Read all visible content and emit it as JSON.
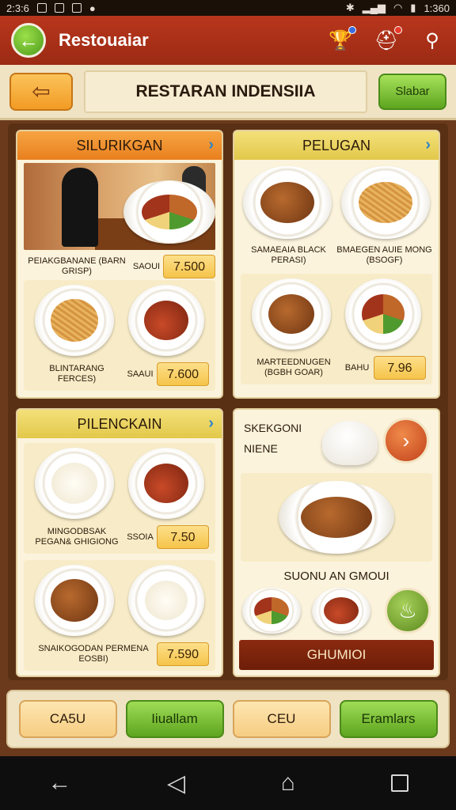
{
  "status_bar": {
    "time": "2:3:6",
    "battery": "1:360"
  },
  "app_bar": {
    "title": "Restouaiar"
  },
  "header": {
    "title": "RESTARAN INDENSIIA",
    "action_label": "Slabar"
  },
  "cards": {
    "c1": {
      "title": "SILURIKGAN",
      "r1": {
        "name": "PEIAKGBANANE (BARN GRISP)",
        "mid": "SAOUI",
        "price": "7.500"
      },
      "r2": {
        "name": "BLINTARANG FERCES)",
        "mid": "SAAUI",
        "price": "7.600"
      }
    },
    "c2": {
      "title": "PELUGAN",
      "r1": {
        "name": "SAMAEAIA BLACK PERASI)",
        "name2": "BMAEGEN AUIE MONG (BSOGF)"
      },
      "r2": {
        "name": "MARTEEDNUGEN (BGBH GOAR)",
        "mid": "BAHU",
        "price": "7.96"
      }
    },
    "c3": {
      "title": "PILENCKAIN",
      "r1": {
        "name": "MINGODBSAK PEGAN& GHIGIONG",
        "mid": "SSOIA",
        "price": "7.50"
      },
      "r2": {
        "name": "SNAIKOGODAN PERMENA EOSBI)",
        "price": "7.590"
      }
    },
    "c4": {
      "text1": "SKEKGONI",
      "text2": "NIENE",
      "caption": "SUONU AN GMOUI",
      "footer": "GHUMIOI"
    }
  },
  "bottom_bar": {
    "b1": "CA5U",
    "b2": "Iiuallam",
    "b3": "CEU",
    "b4": "Eramlars"
  }
}
